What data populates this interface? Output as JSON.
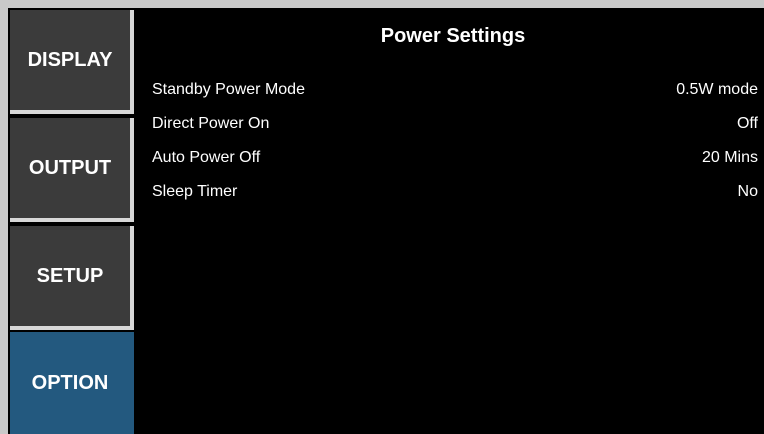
{
  "sidebar": {
    "tabs": [
      {
        "label": "DISPLAY"
      },
      {
        "label": "OUTPUT"
      },
      {
        "label": "SETUP"
      },
      {
        "label": "OPTION"
      }
    ],
    "active_index": 3
  },
  "panel": {
    "title": "Power Settings",
    "rows": [
      {
        "label": "Standby Power Mode",
        "value": "0.5W mode"
      },
      {
        "label": "Direct Power On",
        "value": "Off"
      },
      {
        "label": "Auto Power Off",
        "value": "20 Mins"
      },
      {
        "label": "Sleep Timer",
        "value": "No"
      }
    ]
  },
  "colors": {
    "background": "#000000",
    "frame": "#c9c9c9",
    "tab_inactive": "#3b3b3b",
    "tab_active": "#23597f",
    "text": "#ffffff"
  }
}
